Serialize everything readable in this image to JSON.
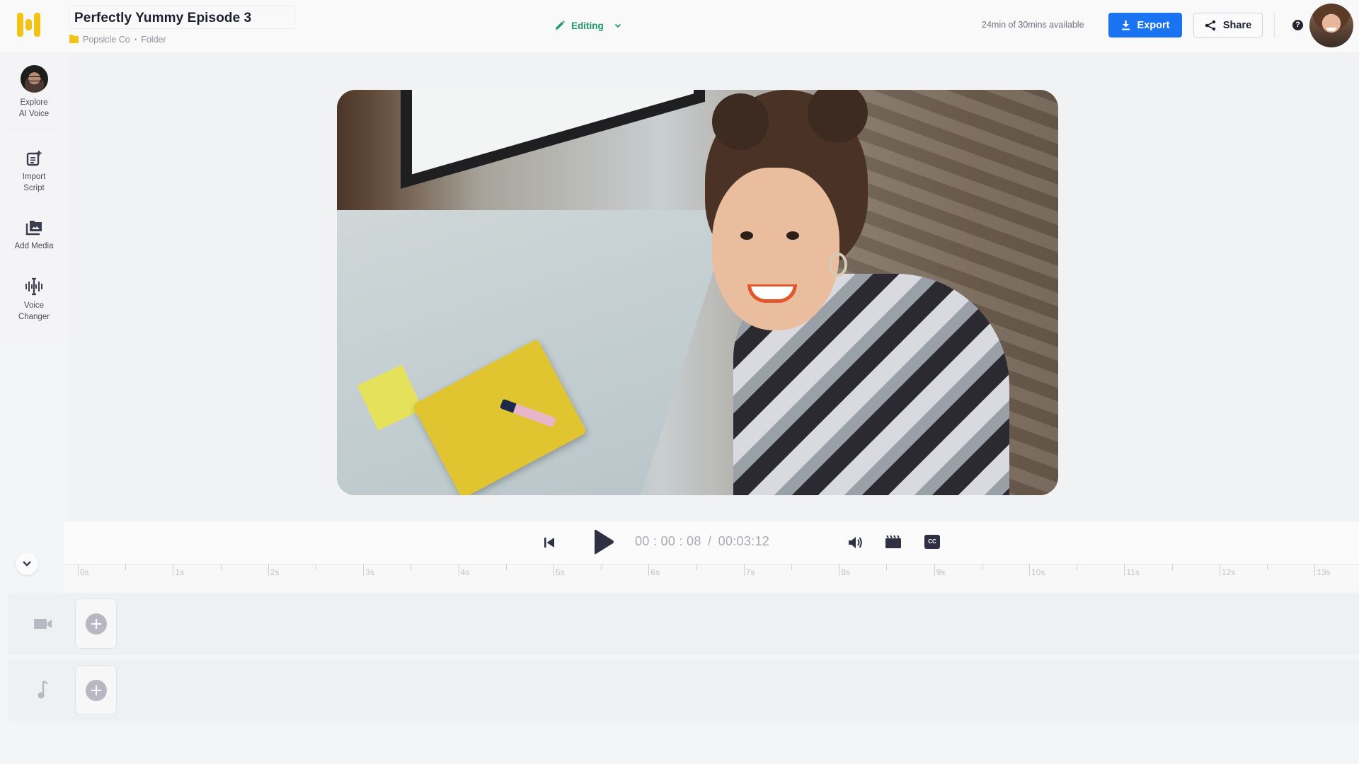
{
  "app": {
    "logo": "app-logo",
    "project_title": "Perfectly Yummy Episode 3",
    "breadcrumb": [
      "Popsicle Co",
      "Folder"
    ],
    "mode_label": "Editing",
    "minutes_available": "24min of 30mins available",
    "export_label": "Export",
    "share_label": "Share",
    "help_label": "?",
    "accent_color": "#1a73f0",
    "editing_color": "#1e9a6a",
    "logo_color": "#f2c314"
  },
  "sidebar": {
    "items": [
      {
        "label_line1": "Explore",
        "label_line2": "AI Voice",
        "icon": "ai-voice-avatar"
      },
      {
        "label_line1": "Import",
        "label_line2": "Script",
        "icon": "import-script-icon"
      },
      {
        "label_line1": "Add Media",
        "label_line2": "",
        "icon": "add-media-icon"
      },
      {
        "label_line1": "Voice",
        "label_line2": "Changer",
        "icon": "voice-changer-icon"
      }
    ]
  },
  "player": {
    "current_time": "00 : 00 : 08",
    "separator": "/",
    "total_time": "00:03:12",
    "controls": [
      "skip-to-start",
      "play",
      "volume",
      "scenes",
      "captions"
    ],
    "cc_label": "CC"
  },
  "timeline": {
    "ticks": [
      "0s",
      "1s",
      "2s",
      "3s",
      "4s",
      "5s",
      "6s",
      "7s",
      "8s",
      "9s",
      "10s",
      "11s",
      "12s",
      "13s"
    ],
    "tracks": [
      {
        "type": "video",
        "icon": "video-camera-icon"
      },
      {
        "type": "audio",
        "icon": "music-note-icon"
      }
    ]
  }
}
